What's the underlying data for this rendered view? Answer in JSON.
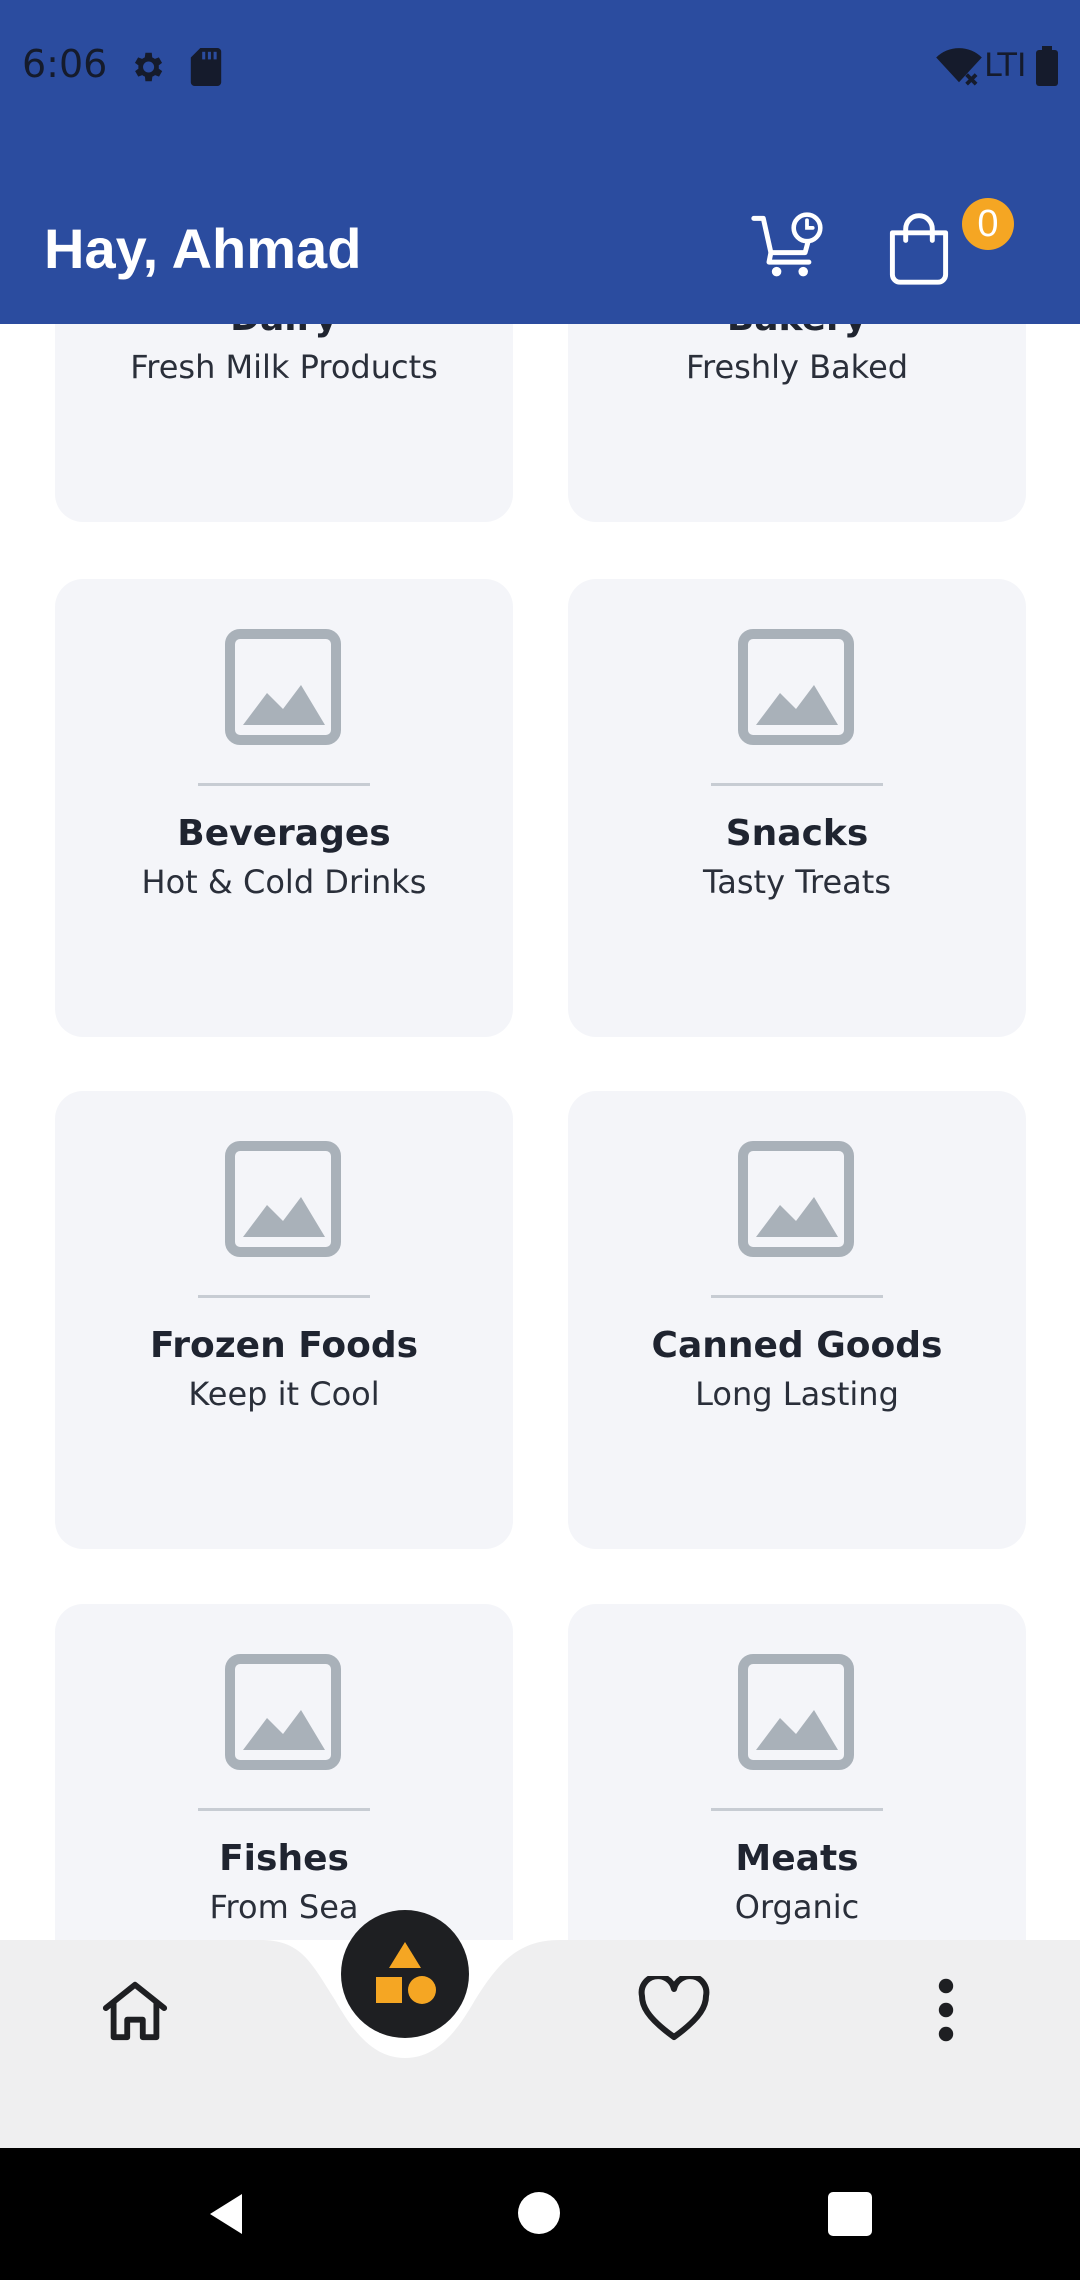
{
  "status_bar": {
    "time": "6:06",
    "network": "LTI",
    "icons": [
      "gear-icon",
      "sd-card-icon",
      "wifi-icon",
      "battery-icon"
    ]
  },
  "header": {
    "title": "Hay, Ahmad",
    "cart_badge": "0",
    "background": "#2b4c9f",
    "badge_color": "#f5a623"
  },
  "categories": [
    {
      "title": "Dairy",
      "subtitle": "Fresh Milk Products"
    },
    {
      "title": "Bakery",
      "subtitle": "Freshly Baked"
    },
    {
      "title": "Beverages",
      "subtitle": "Hot & Cold Drinks"
    },
    {
      "title": "Snacks",
      "subtitle": "Tasty Treats"
    },
    {
      "title": "Frozen Foods",
      "subtitle": "Keep it Cool"
    },
    {
      "title": "Canned Goods",
      "subtitle": "Long Lasting"
    },
    {
      "title": "Fishes",
      "subtitle": "From Sea"
    },
    {
      "title": "Meats",
      "subtitle": "Organic"
    }
  ],
  "bottom_nav": {
    "items": [
      "home-icon",
      "categories-icon",
      "heart-icon",
      "more-vert-icon"
    ],
    "accent": "#f5a623"
  }
}
